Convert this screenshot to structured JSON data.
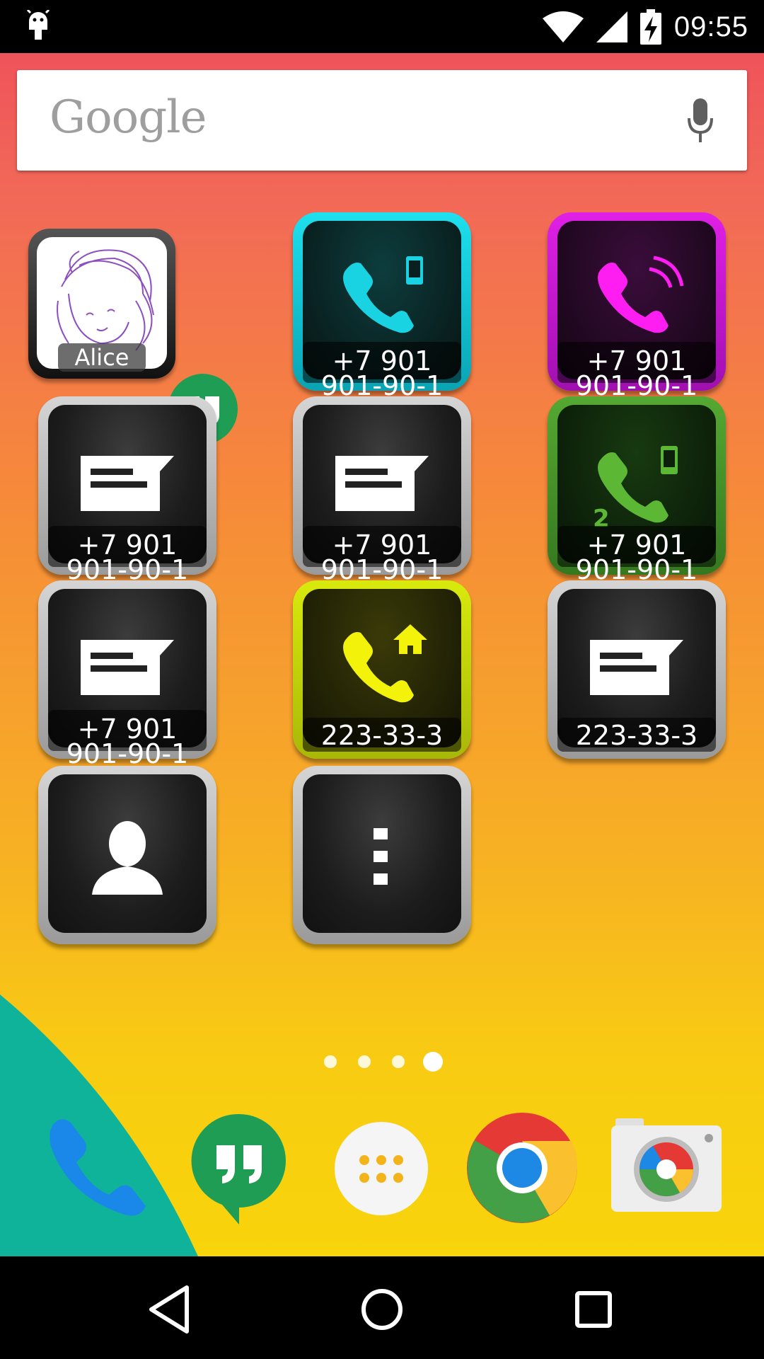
{
  "status_bar": {
    "time": "09:55",
    "icons": [
      "android-debug-icon",
      "wifi-icon",
      "cell-signal-icon",
      "battery-charging-icon"
    ]
  },
  "search": {
    "logo_text": "Google",
    "icons": [
      "mic-icon"
    ]
  },
  "widgets": {
    "contact": {
      "name": "Alice"
    },
    "tiles": [
      {
        "id": "call-mobile",
        "icon": "phone-mobile-icon",
        "color": "#19d3e3",
        "label_line1": "+7 901",
        "label_line2": "901-90-1"
      },
      {
        "id": "call-incoming",
        "icon": "phone-ringing-icon",
        "color": "#ff1ef2",
        "label_line1": "+7 901",
        "label_line2": "901-90-1"
      },
      {
        "id": "sms-1",
        "icon": "message-icon",
        "color": "#ffffff",
        "label_line1": "+7 901",
        "label_line2": "901-90-1"
      },
      {
        "id": "sms-2",
        "icon": "message-icon",
        "color": "#ffffff",
        "label_line1": "+7 901",
        "label_line2": "901-90-1"
      },
      {
        "id": "call-sim2",
        "icon": "phone-mobile-sim2-icon",
        "color": "#5cb834",
        "badge": "2",
        "label_line1": "+7 901",
        "label_line2": "901-90-1"
      },
      {
        "id": "sms-3",
        "icon": "message-icon",
        "color": "#ffffff",
        "label_line1": "+7 901",
        "label_line2": "901-90-1"
      },
      {
        "id": "call-home",
        "icon": "phone-home-icon",
        "color": "#f2f20a",
        "label_line1": "223-33-3"
      },
      {
        "id": "sms-home",
        "icon": "message-icon",
        "color": "#ffffff",
        "label_line1": "223-33-3"
      },
      {
        "id": "contacts",
        "icon": "person-icon",
        "color": "#ffffff"
      },
      {
        "id": "more",
        "icon": "more-vert-icon",
        "color": "#ffffff"
      }
    ]
  },
  "page_indicator": {
    "count": 4,
    "active_index": 3
  },
  "dock": [
    "phone-app-icon",
    "hangouts-app-icon",
    "app-drawer-icon",
    "chrome-app-icon",
    "camera-app-icon"
  ],
  "nav_bar": [
    "back-icon",
    "home-icon",
    "recents-icon"
  ]
}
